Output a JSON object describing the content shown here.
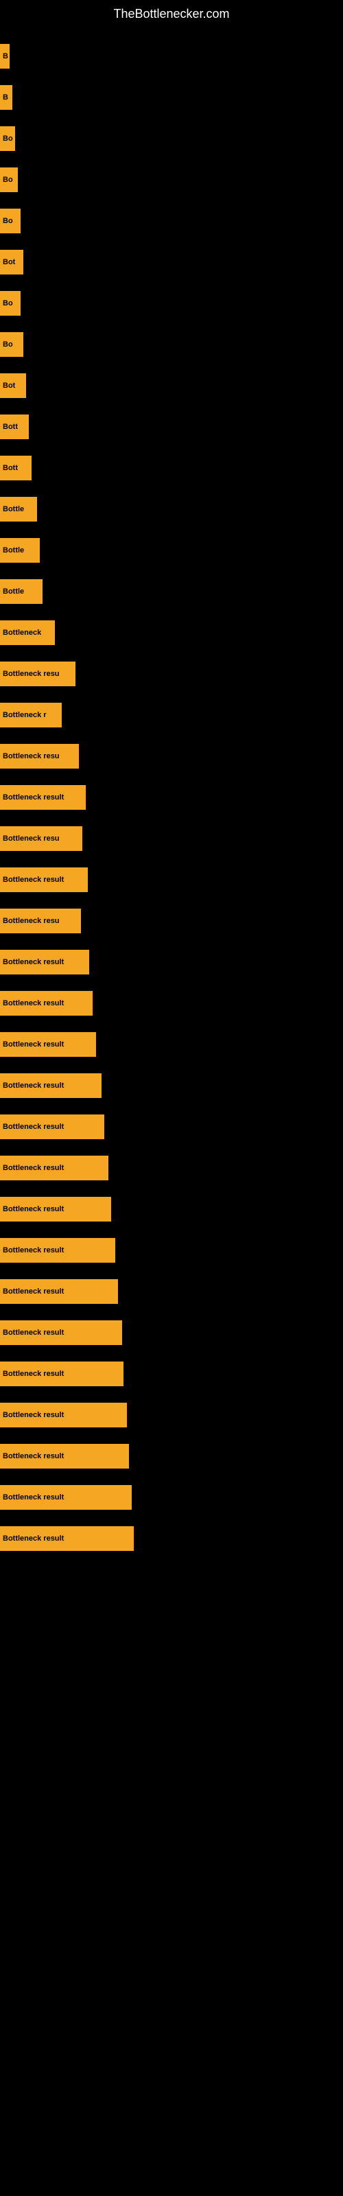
{
  "site": {
    "title": "TheBottlenecker.com"
  },
  "bars": [
    {
      "id": 1,
      "label": "B",
      "width": 14
    },
    {
      "id": 2,
      "label": "B",
      "width": 18
    },
    {
      "id": 3,
      "label": "Bo",
      "width": 22
    },
    {
      "id": 4,
      "label": "Bo",
      "width": 26
    },
    {
      "id": 5,
      "label": "Bo",
      "width": 30
    },
    {
      "id": 6,
      "label": "Bot",
      "width": 34
    },
    {
      "id": 7,
      "label": "Bo",
      "width": 30
    },
    {
      "id": 8,
      "label": "Bo",
      "width": 34
    },
    {
      "id": 9,
      "label": "Bot",
      "width": 38
    },
    {
      "id": 10,
      "label": "Bott",
      "width": 42
    },
    {
      "id": 11,
      "label": "Bott",
      "width": 46
    },
    {
      "id": 12,
      "label": "Bottle",
      "width": 54
    },
    {
      "id": 13,
      "label": "Bottle",
      "width": 58
    },
    {
      "id": 14,
      "label": "Bottle",
      "width": 62
    },
    {
      "id": 15,
      "label": "Bottleneck",
      "width": 80
    },
    {
      "id": 16,
      "label": "Bottleneck resu",
      "width": 110
    },
    {
      "id": 17,
      "label": "Bottleneck r",
      "width": 90
    },
    {
      "id": 18,
      "label": "Bottleneck resu",
      "width": 115
    },
    {
      "id": 19,
      "label": "Bottleneck result",
      "width": 125
    },
    {
      "id": 20,
      "label": "Bottleneck resu",
      "width": 120
    },
    {
      "id": 21,
      "label": "Bottleneck result",
      "width": 128
    },
    {
      "id": 22,
      "label": "Bottleneck resu",
      "width": 118
    },
    {
      "id": 23,
      "label": "Bottleneck result",
      "width": 130
    },
    {
      "id": 24,
      "label": "Bottleneck result",
      "width": 135
    },
    {
      "id": 25,
      "label": "Bottleneck result",
      "width": 140
    },
    {
      "id": 26,
      "label": "Bottleneck result",
      "width": 148
    },
    {
      "id": 27,
      "label": "Bottleneck result",
      "width": 152
    },
    {
      "id": 28,
      "label": "Bottleneck result",
      "width": 158
    },
    {
      "id": 29,
      "label": "Bottleneck result",
      "width": 162
    },
    {
      "id": 30,
      "label": "Bottleneck result",
      "width": 168
    },
    {
      "id": 31,
      "label": "Bottleneck result",
      "width": 172
    },
    {
      "id": 32,
      "label": "Bottleneck result",
      "width": 178
    },
    {
      "id": 33,
      "label": "Bottleneck result",
      "width": 180
    },
    {
      "id": 34,
      "label": "Bottleneck result",
      "width": 185
    },
    {
      "id": 35,
      "label": "Bottleneck result",
      "width": 188
    },
    {
      "id": 36,
      "label": "Bottleneck result",
      "width": 192
    },
    {
      "id": 37,
      "label": "Bottleneck result",
      "width": 195
    }
  ]
}
